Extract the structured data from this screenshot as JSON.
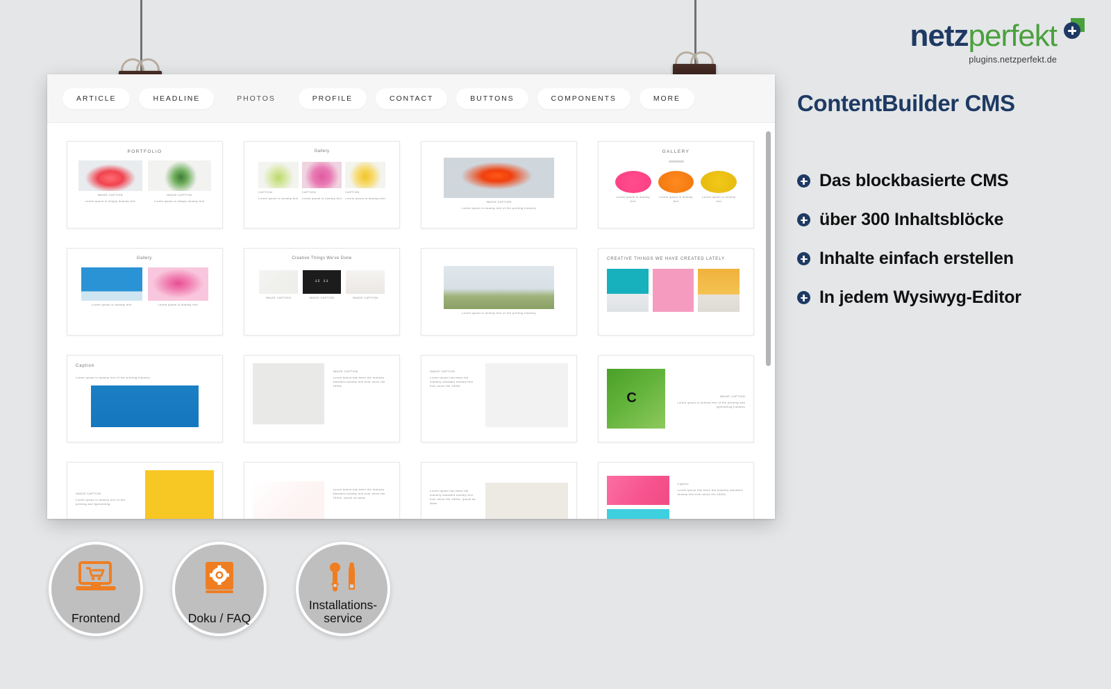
{
  "brand": {
    "logo_part1": "netz",
    "logo_part2": "perfekt",
    "logo_sub": "plugins.netzperfekt.de",
    "plus_badge_icon": "plus-badge-icon",
    "navy": "#1e3a63",
    "green": "#4aa03c",
    "orange": "#ef7e22"
  },
  "headline": "ContentBuilder CMS",
  "features": [
    {
      "icon": "plus-circle-icon",
      "label": "Das blockbasierte CMS"
    },
    {
      "icon": "plus-circle-icon",
      "label": "über 300 Inhaltsblöcke"
    },
    {
      "icon": "plus-circle-icon",
      "label": "Inhalte einfach erstellen"
    },
    {
      "icon": "plus-circle-icon",
      "label": "In jedem Wysiwyg-Editor"
    }
  ],
  "toolbar": {
    "tabs": [
      {
        "label": "ARTICLE",
        "active": false
      },
      {
        "label": "HEADLINE",
        "active": false
      },
      {
        "label": "PHOTOS",
        "active": true
      },
      {
        "label": "PROFILE",
        "active": false
      },
      {
        "label": "CONTACT",
        "active": false
      },
      {
        "label": "BUTTONS",
        "active": false
      },
      {
        "label": "COMPONENTS",
        "active": false
      },
      {
        "label": "MORE",
        "active": false
      }
    ]
  },
  "blocks": [
    {
      "title": "PORTFOLIO",
      "caption1": "IMAGE CAPTION",
      "caption2": "IMAGE CAPTION",
      "sub": "Lorem ipsum is simply dummy text"
    },
    {
      "title": "Gallery",
      "caption1": "CAPTION",
      "caption2": "CAPTION",
      "caption3": "CAPTION",
      "sub": "Lorem ipsum is dummy text"
    },
    {
      "title": "",
      "caption1": "IMAGE CAPTION",
      "sub": "Lorem ipsum is dummy text of the printing industry"
    },
    {
      "title": "GALLERY",
      "caption1": "Lorem ipsum is dummy text",
      "caption2": "Lorem ipsum is dummy text",
      "caption3": "Lorem ipsum is dummy text"
    },
    {
      "title": "Gallery.",
      "caption1": "Lorem ipsum is dummy text",
      "caption2": "Lorem ipsum is dummy text"
    },
    {
      "title": "Creative Things We've Done",
      "caption1": "IMAGE CAPTION",
      "caption2": "IMAGE CAPTION",
      "caption3": "IMAGE CAPTION"
    },
    {
      "title": "",
      "caption1": "Lorem ipsum is dummy text of the printing industry"
    },
    {
      "title": "CREATIVE THINGS WE HAVE CREATED LATELY"
    },
    {
      "title": "Caption",
      "sub": "Lorem ipsum is dummy text of the printing industry"
    },
    {
      "title": "IMAGE CAPTION",
      "sub": "Lorem ipsum has been the industry standard dummy text ever since the 1500s"
    },
    {
      "title": "IMAGE CAPTION",
      "sub": "Lorem ipsum has been the industry standard dummy text ever since the 1500s"
    },
    {
      "title": "IMAGE CAPTION",
      "sub": "Lorem ipsum is dummy text of the printing and typesetting industry"
    },
    {
      "title": "IMAGE CAPTION",
      "sub": "Lorem ipsum is dummy text of the printing and typesetting"
    },
    {
      "title": "",
      "sub": "Lorem ipsum has been the industry standard dummy text ever since the 1500s. Ipsum as lama."
    },
    {
      "title": "",
      "sub": "Lorem ipsum has been the industry standard dummy text ever since the 1500s. Ipsum as lama."
    },
    {
      "title": "Caption",
      "sub": "Lorem ipsum has been the industry standard dummy text ever since the 1500s."
    }
  ],
  "badges": [
    {
      "icon": "laptop-cart-icon",
      "label": "Frontend"
    },
    {
      "icon": "book-gear-icon",
      "label": "Doku / FAQ"
    },
    {
      "icon": "wrench-screwdriver-icon",
      "label": "Installations-\nservice"
    }
  ],
  "scrollbar": {
    "name": "vertical-scrollbar"
  }
}
